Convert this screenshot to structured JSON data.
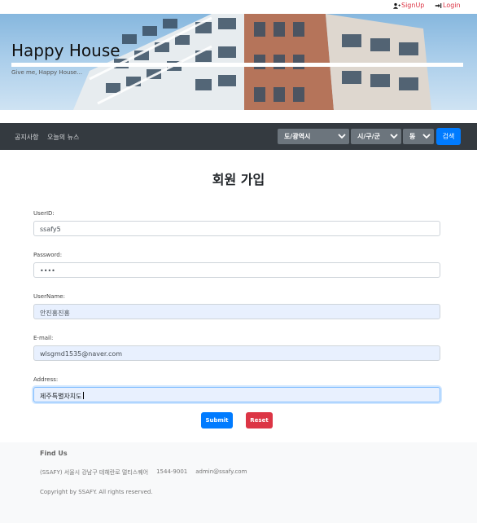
{
  "topbar": {
    "signup_label": "SignUp",
    "login_label": "Login"
  },
  "hero": {
    "title": "Happy House",
    "subtitle": "Give me, Happy House..."
  },
  "nav": {
    "links": [
      "공지사항",
      "오늘의 뉴스"
    ],
    "sido_label": "도/광역시",
    "gugun_label": "시/구/군",
    "dong_label": "동",
    "search_label": "검색"
  },
  "form": {
    "title": "회원 가입",
    "userid": {
      "label": "UserID:",
      "value": "ssafy5"
    },
    "password": {
      "label": "Password:",
      "value": "••••"
    },
    "username": {
      "label": "UserName:",
      "value": "안진홍진홍"
    },
    "email": {
      "label": "E-mail:",
      "value": "wlsgmd1535@naver.com"
    },
    "address": {
      "label": "Address:",
      "value": "제주특별자치도"
    },
    "submit_label": "Submit",
    "reset_label": "Reset"
  },
  "footer": {
    "heading": "Find Us",
    "org": "(SSAFY) 서울시 강남구 테헤란로 멀티스퀘어",
    "phone": "1544-9001",
    "email": "admin@ssafy.com",
    "copyright": "Copyright by SSAFY. All rights reserved."
  },
  "colors": {
    "primary": "#007bff",
    "danger": "#dc3545",
    "navbar": "#343a40",
    "select": "#6c757d"
  }
}
